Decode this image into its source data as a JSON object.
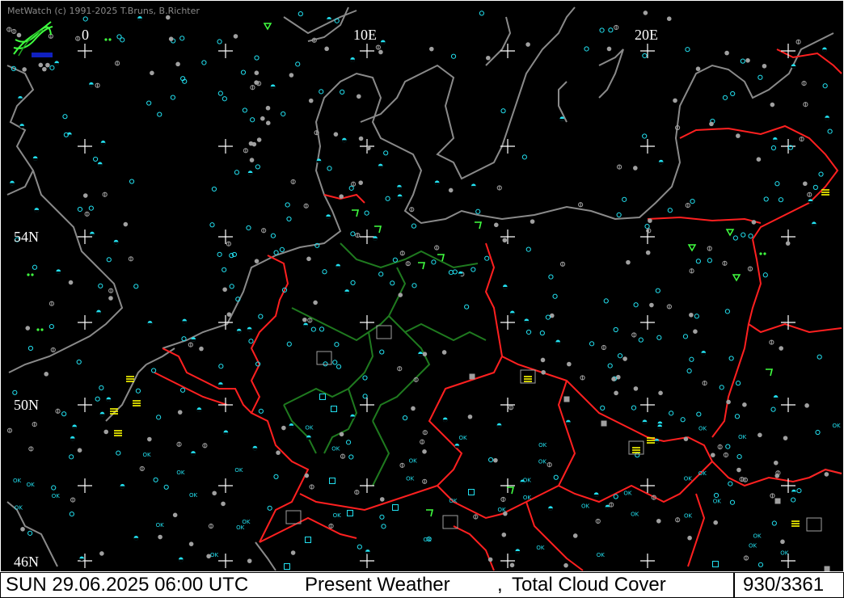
{
  "app": {
    "copyright": "MetWatch  (c) 1991-2025 T.Bruns, B.Richter",
    "logo_icon": "metwatch-logo-icon"
  },
  "map": {
    "longitude_labels": [
      "0",
      "10E",
      "20E"
    ],
    "latitude_labels": [
      "54N",
      "50N",
      "46N"
    ],
    "colors": {
      "background": "#000000",
      "coastline": "#8a8a8a",
      "country_border": "#ff2020",
      "state_border": "#1f7a1f",
      "station_cyan": "#22e0f0",
      "station_gray": "#a0a0a0",
      "weather_yellow": "#ffff00",
      "weather_green": "#40ff40",
      "grid_cross": "#ffffff"
    },
    "station_symbols": [
      "clear-sky-circle",
      "partly-cloudy-circle",
      "overcast-circle",
      "ok-label",
      "fog-symbol",
      "rain-symbol",
      "thunder-symbol"
    ],
    "ok_label": "OK"
  },
  "status": {
    "datetime": "SUN 29.06.2025 06:00 UTC",
    "parameter1": "Present Weather",
    "separator": ",",
    "parameter2": "Total Cloud Cover",
    "count": "930/3361"
  }
}
